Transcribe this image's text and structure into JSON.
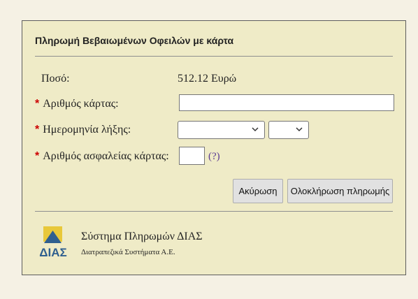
{
  "form": {
    "title": "Πληρωμή Βεβαιωμένων Οφειλών με κάρτα",
    "required_mark": "*",
    "amount_label": "Ποσό:",
    "amount_value": "512.12 Ευρώ",
    "card_number_label": "Αριθμός κάρτας:",
    "card_number_value": "",
    "expiry_label": "Ημερομηνία λήξης:",
    "expiry_month_value": "",
    "expiry_year_value": "",
    "cvv_label": "Αριθμός ασφαλείας κάρτας:",
    "cvv_value": "",
    "cvv_help": "(?)"
  },
  "buttons": {
    "cancel": "Ακύρωση",
    "complete": "Ολοκλήρωση πληρωμής"
  },
  "footer": {
    "logo_text": "ΔΙΑΣ",
    "system_name": "Σύστημα Πληρωμών ΔΙΑΣ",
    "company": "Διατραπεζικά Συστήματα Α.Ε."
  },
  "colors": {
    "panel_bg": "#efebc7",
    "page_bg": "#f5f1e4",
    "required": "#cc0000",
    "logo_blue": "#2f5f8f",
    "logo_yellow": "#e8c83a"
  }
}
